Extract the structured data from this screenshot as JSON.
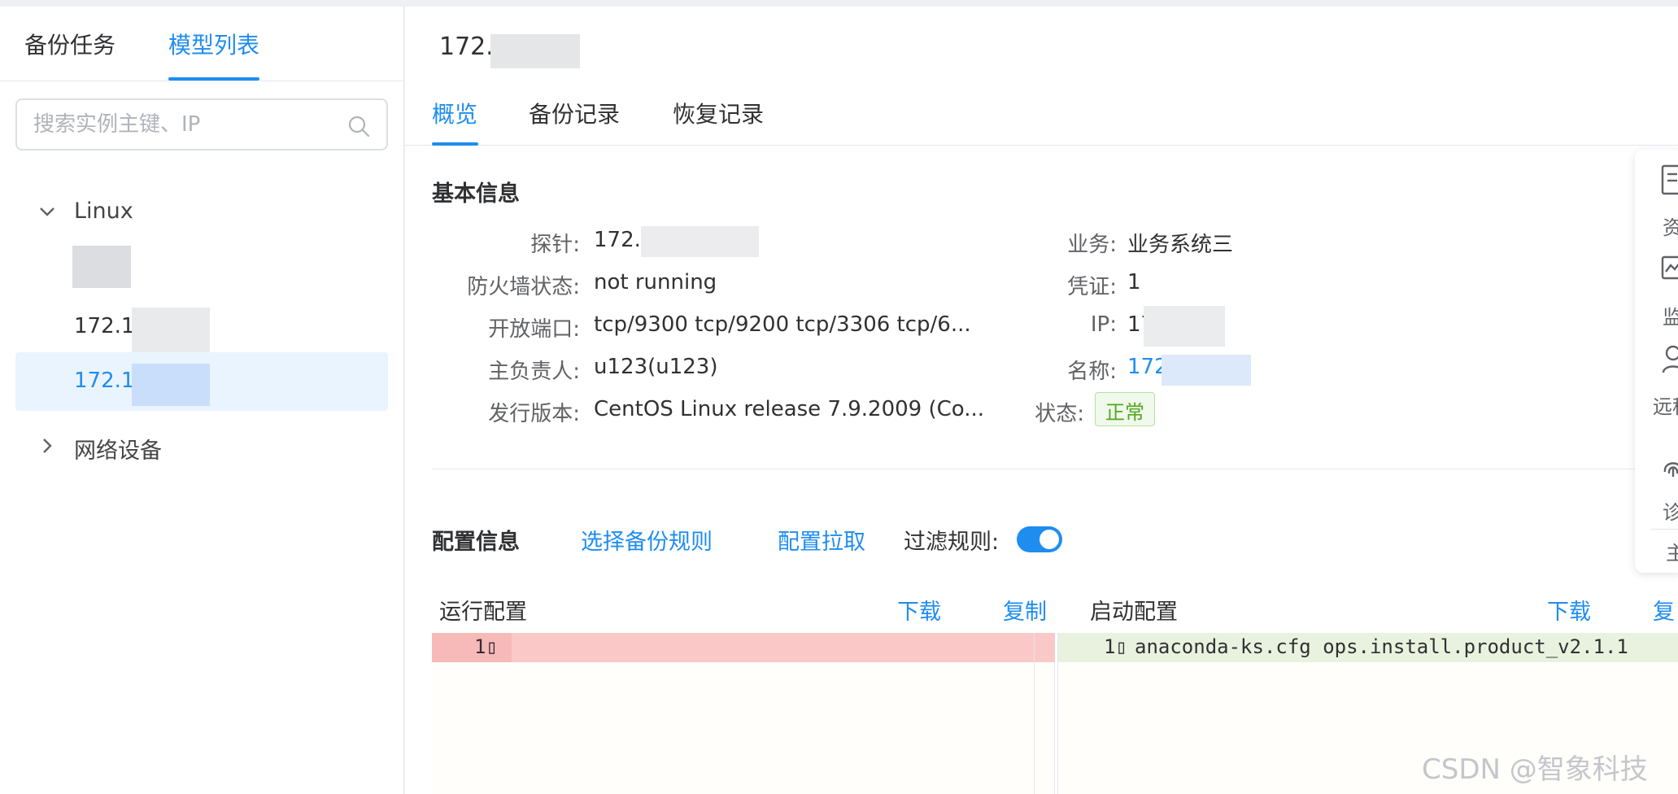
{
  "sidebar": {
    "tabs": [
      {
        "label": "备份任务"
      },
      {
        "label": "模型列表"
      }
    ],
    "search": {
      "placeholder": "搜索实例主键、IP"
    },
    "tree": {
      "linux_label": "Linux",
      "leaves": [
        {
          "label": ""
        },
        {
          "label": "172.1("
        },
        {
          "label": "172.1("
        }
      ],
      "network_label": "网络设备"
    }
  },
  "main": {
    "host_title": "172.",
    "tabs": [
      {
        "label": "概览"
      },
      {
        "label": "备份记录"
      },
      {
        "label": "恢复记录"
      }
    ],
    "basic_info": {
      "title": "基本信息",
      "left": [
        {
          "key": "探针:",
          "value": "172.                  nline"
        },
        {
          "key": "防火墙状态:",
          "value": "not running"
        },
        {
          "key": "开放端口:",
          "value": "tcp/9300 tcp/9200 tcp/3306 tcp/6..."
        },
        {
          "key": "主负责人:",
          "value": "u123(u123)"
        },
        {
          "key": "发行版本:",
          "value": "CentOS Linux release 7.9.2009 (Co..."
        }
      ],
      "right": [
        {
          "key": "业务:",
          "value": "业务系统三"
        },
        {
          "key": "凭证:",
          "value": "1"
        },
        {
          "key": "IP:",
          "value": "17          42"
        },
        {
          "key": "名称:",
          "value": "172"
        },
        {
          "key": "状态:",
          "value": "正常"
        }
      ]
    },
    "config": {
      "title": "配置信息",
      "select_rule_link": "选择备份规则",
      "pull_link": "配置拉取",
      "filter_label": "过滤规则:",
      "filter_on": true,
      "running": {
        "title": "运行配置",
        "download": "下载",
        "copy": "复制",
        "line_no": "1",
        "line_mark": "▯"
      },
      "startup": {
        "title": "启动配置",
        "download": "下载",
        "copy": "复",
        "line_no": "1",
        "line_mark": "▯",
        "code": "anaconda-ks.cfg  ops.install.product_v2.1.1"
      }
    }
  },
  "float_bar": {
    "items": [
      {
        "icon": "asset-icon",
        "label": "资"
      },
      {
        "icon": "monitor-icon",
        "label": "监"
      },
      {
        "icon": "user-icon",
        "label": "远程"
      },
      {
        "icon": "fingerprint-icon",
        "label": "诊"
      }
    ],
    "more_label": "主"
  },
  "watermark": "CSDN @智象科技",
  "colors": {
    "accent": "#1f8df0",
    "success": "#52a820",
    "diff_removed": "#fbc8c8",
    "diff_added": "#e9f2de"
  }
}
